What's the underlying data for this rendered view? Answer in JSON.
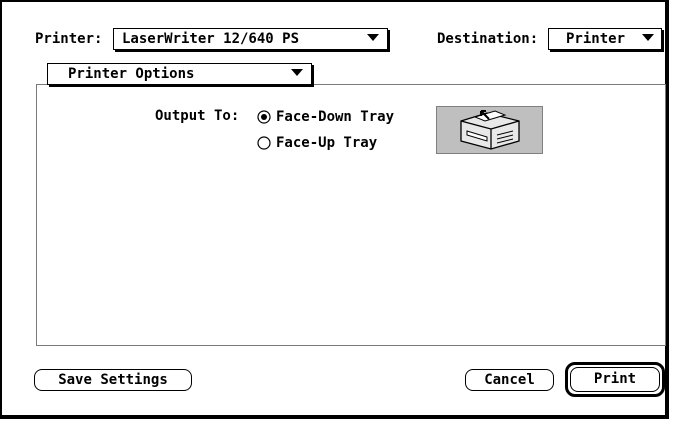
{
  "header": {
    "printer_label": "Printer:",
    "printer_value": "LaserWriter 12/640 PS",
    "destination_label": "Destination:",
    "destination_value": "Printer"
  },
  "options_menu": {
    "value": "Printer Options"
  },
  "output": {
    "label": "Output To:",
    "options": [
      {
        "label": "Face-Down Tray",
        "selected": true
      },
      {
        "label": "Face-Up Tray",
        "selected": false
      }
    ],
    "icon": "printer-tray-icon"
  },
  "footer": {
    "save_label": "Save Settings",
    "cancel_label": "Cancel",
    "print_label": "Print"
  }
}
